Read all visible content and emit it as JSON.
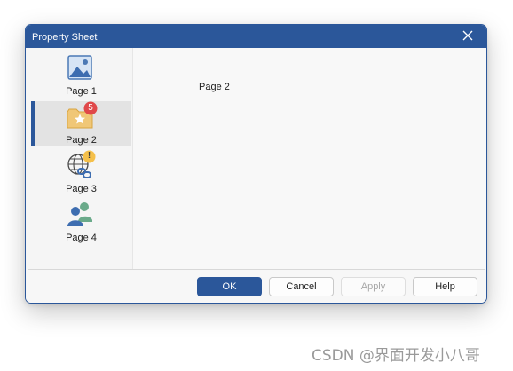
{
  "window": {
    "title": "Property Sheet"
  },
  "colors": {
    "accent": "#2b579a",
    "badge": "#e0484a",
    "warning": "#f5c04a"
  },
  "sidebar": {
    "items": [
      {
        "label": "Page 1",
        "icon": "image-icon",
        "selected": false
      },
      {
        "label": "Page 2",
        "icon": "star-folder-icon",
        "selected": true,
        "badge": "5"
      },
      {
        "label": "Page 3",
        "icon": "globe-link-icon",
        "selected": false,
        "badge": "!"
      },
      {
        "label": "Page 4",
        "icon": "users-icon",
        "selected": false
      }
    ]
  },
  "content": {
    "page_label": "Page 2"
  },
  "buttons": {
    "ok": "OK",
    "cancel": "Cancel",
    "apply": "Apply",
    "help": "Help"
  },
  "watermark": "CSDN @界面开发小八哥"
}
